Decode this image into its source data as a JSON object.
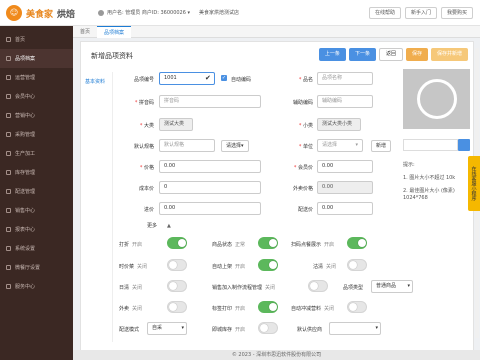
{
  "header": {
    "logo_text": "美食家",
    "logo_sub": "烘焙",
    "user_text": "用户名: 管理员 商户ID: 36000026 ▾",
    "shop_name": "美食家烘焙测试店",
    "buttons": [
      "在线帮助",
      "新手入门",
      "我要购买"
    ]
  },
  "sidebar": {
    "items": [
      {
        "label": "首页",
        "active": false
      },
      {
        "label": "品项档案",
        "active": true
      },
      {
        "label": "运营管理",
        "active": false
      },
      {
        "label": "会员中心",
        "active": false
      },
      {
        "label": "营销中心",
        "active": false
      },
      {
        "label": "采购管理",
        "active": false
      },
      {
        "label": "生产加工",
        "active": false
      },
      {
        "label": "库存管理",
        "active": false
      },
      {
        "label": "配送管理",
        "active": false
      },
      {
        "label": "销售中心",
        "active": false
      },
      {
        "label": "报表中心",
        "active": false
      },
      {
        "label": "系统设置",
        "active": false
      },
      {
        "label": "微餐厅设置",
        "active": false
      },
      {
        "label": "服务中心",
        "active": false
      }
    ]
  },
  "tabs": [
    {
      "label": "首页",
      "active": false
    },
    {
      "label": "品项档案",
      "active": true
    }
  ],
  "panel": {
    "title": "新增品项资料",
    "actions": [
      "上一条",
      "下一条",
      "返回",
      "保存",
      "保存并新增"
    ],
    "subnav": "基本资料"
  },
  "form": {
    "code_label": "品项编号",
    "code_value": "1001",
    "auto_code_label": "自动编码",
    "name_label": "品名",
    "name_placeholder": "品项名称",
    "pinyin_label": "拼音码",
    "pinyin_placeholder": "拼音码",
    "aux_label": "辅助编码",
    "aux_placeholder": "辅助编码",
    "major_label": "大类",
    "major_value": "测试大类",
    "minor_label": "小类",
    "minor_value": "测试大类小类",
    "spec_label": "默认规格",
    "spec_placeholder": "默认规格",
    "spec_btn": "请选择▾",
    "unit_label": "单位",
    "unit_value": "请选择",
    "unit_new": "新增",
    "price_label": "价格",
    "price_value": "0.00",
    "member_price_label": "会员价",
    "member_price_value": "0.00",
    "cost_label": "成本价",
    "cost_value": "0",
    "takeout_label": "外卖价格",
    "takeout_value": "0.00",
    "purchase_label": "进价",
    "purchase_value": "0.00",
    "delivery_label": "配送价",
    "delivery_value": "0.00",
    "more_label": "更多",
    "more_arrow": "▲"
  },
  "toggles": {
    "discount": {
      "label": "打折",
      "state": "开启",
      "on": true
    },
    "status": {
      "label": "商品状态",
      "state": "正常",
      "on": true
    },
    "scan_display": {
      "label": "扫码点餐展示",
      "state": "开启",
      "on": true
    },
    "timed_price": {
      "label": "时价菜",
      "state": "关闭",
      "on": false
    },
    "auto_shelf": {
      "label": "自动上架",
      "state": "开启",
      "on": true
    },
    "sold_out": {
      "label": "沽清",
      "state": "关闭",
      "on": false
    },
    "daily_clear": {
      "label": "日清",
      "state": "关闭",
      "on": false
    },
    "sale_process": {
      "label": "销售加入制作流程管理",
      "state": "关闭",
      "on": false
    },
    "label_print": {
      "label": "标签打印",
      "state": "开启",
      "on": true
    },
    "auto_reduce": {
      "label": "自动冲减营料",
      "state": "关闭",
      "on": false
    },
    "takeout": {
      "label": "外卖",
      "state": "关闭",
      "on": false
    },
    "neg_stock": {
      "label": "即城库存",
      "state": "开启",
      "on": false
    }
  },
  "selects": {
    "goods_type_label": "品项类型",
    "goods_type_value": "普通商品",
    "delivery_mode_label": "配送模式",
    "delivery_mode_value": "自采",
    "supplier_label": "默认供应商",
    "supplier_value": ""
  },
  "image_area": {
    "tips_title": "提示:",
    "tip1": "1. 图片大小不超过 10k",
    "tip2": "2. 最佳图片大小 (像素)",
    "tip3": "1024*768"
  },
  "float_label": "在线客服小程序",
  "footer": "© 2023 - 深圳市思迅软件股份有限公司"
}
